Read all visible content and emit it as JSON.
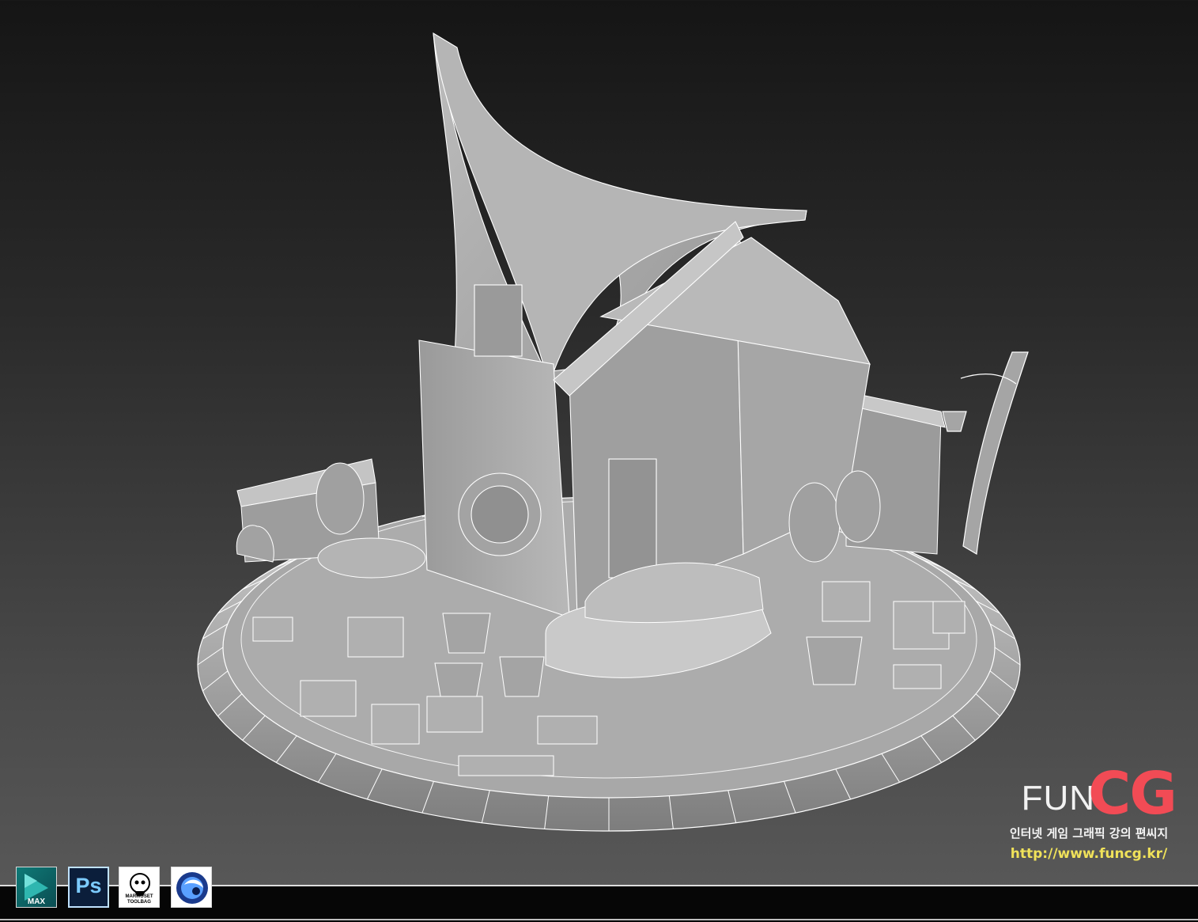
{
  "viewport": {
    "background_top": "#151515",
    "background_bottom": "#5a5a5a",
    "model_fill": "#a9a9a9",
    "wire_color": "#ffffff"
  },
  "branding": {
    "logo_fun": "FUN",
    "logo_cg": "CG",
    "logo_cg_color": "#f24b55",
    "tagline": "인터넷 게임 그래픽 강의 편씨지",
    "url": "http://www.funcg.kr/",
    "url_color": "#f0e25a"
  },
  "toolbar": {
    "apps": [
      {
        "name": "3ds Max",
        "label": "MAX",
        "icon": "3dsmax-icon"
      },
      {
        "name": "Photoshop",
        "label": "Ps",
        "icon": "photoshop-icon"
      },
      {
        "name": "Marmoset Toolbag",
        "label": "MARMOSET TOOLBAG",
        "icon": "marmoset-icon"
      },
      {
        "name": "Cinema 4D",
        "label": "",
        "icon": "cinema4d-icon"
      }
    ]
  }
}
